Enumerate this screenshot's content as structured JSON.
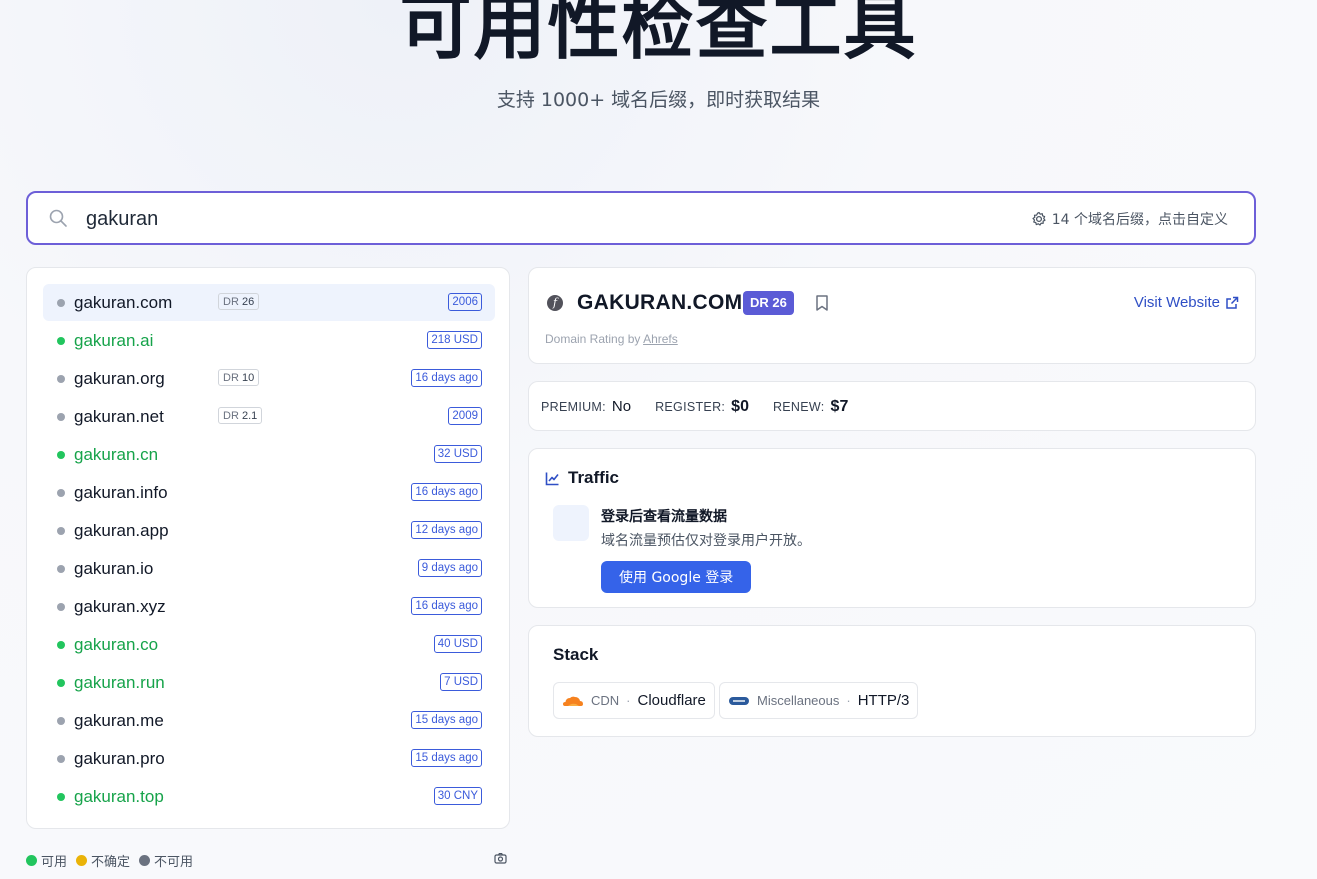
{
  "hero": {
    "title": "可用性检查工具",
    "subtitle": "支持 1000+ 域名后缀，即时获取结果"
  },
  "search": {
    "value": "gakuran",
    "tld_config_label": "14 个域名后缀，点击自定义"
  },
  "colors": {
    "available": "#22c55e",
    "uncertain": "#eab308",
    "unavailable": "#6b7280",
    "accent": "#6d5fd8",
    "tag": "#3b5bdb"
  },
  "domains": [
    {
      "name": "gakuran.com",
      "status": "unavailable",
      "dr_label": "DR",
      "dr_value": "26",
      "tag": "2006",
      "selected": true
    },
    {
      "name": "gakuran.ai",
      "status": "available",
      "tag": "218 USD"
    },
    {
      "name": "gakuran.org",
      "status": "unavailable",
      "dr_label": "DR",
      "dr_value": "10",
      "tag": "16 days ago"
    },
    {
      "name": "gakuran.net",
      "status": "unavailable",
      "dr_label": "DR",
      "dr_value": "2.1",
      "tag": "2009"
    },
    {
      "name": "gakuran.cn",
      "status": "available",
      "tag": "32 USD"
    },
    {
      "name": "gakuran.info",
      "status": "unavailable",
      "tag": "16 days ago"
    },
    {
      "name": "gakuran.app",
      "status": "unavailable",
      "tag": "12 days ago"
    },
    {
      "name": "gakuran.io",
      "status": "unavailable",
      "tag": "9 days ago"
    },
    {
      "name": "gakuran.xyz",
      "status": "unavailable",
      "tag": "16 days ago"
    },
    {
      "name": "gakuran.co",
      "status": "available",
      "tag": "40 USD"
    },
    {
      "name": "gakuran.run",
      "status": "available",
      "tag": "7 USD"
    },
    {
      "name": "gakuran.me",
      "status": "unavailable",
      "tag": "15 days ago"
    },
    {
      "name": "gakuran.pro",
      "status": "unavailable",
      "tag": "15 days ago"
    },
    {
      "name": "gakuran.top",
      "status": "available",
      "tag": "30 CNY"
    }
  ],
  "legend": {
    "available": "可用",
    "uncertain": "不确定",
    "unavailable": "不可用"
  },
  "detail": {
    "favicon_glyph": "f",
    "title": "GAKURAN.COM",
    "dr_badge": "DR 26",
    "visit_label": "Visit Website",
    "rating_prefix": "Domain Rating by",
    "rating_source": "Ahrefs"
  },
  "pricing": {
    "premium_label": "PREMIUM:",
    "premium_value": "No",
    "register_label": "REGISTER:",
    "register_value": "$0",
    "renew_label": "RENEW:",
    "renew_value": "$7"
  },
  "traffic": {
    "heading": "Traffic",
    "login_title": "登录后查看流量数据",
    "login_desc": "域名流量预估仅对登录用户开放。",
    "google_button": "使用 Google 登录"
  },
  "stack": {
    "heading": "Stack",
    "items": [
      {
        "category": "CDN",
        "value": "Cloudflare",
        "icon": "cloudflare-icon"
      },
      {
        "category": "Miscellaneous",
        "value": "HTTP/3",
        "icon": "http3-icon"
      }
    ]
  }
}
